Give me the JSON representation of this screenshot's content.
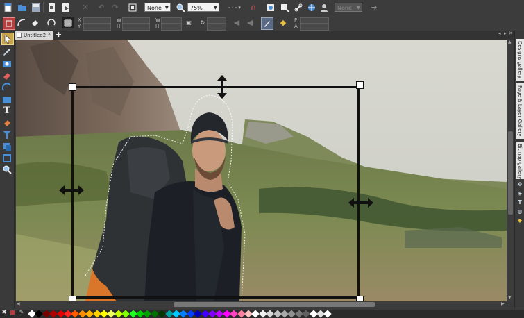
{
  "toolbar": {
    "quality_value": "None",
    "zoom_value": "75%",
    "disabled_combo_value": "None"
  },
  "document_tab": {
    "title": "Untitled2",
    "close_glyph": "×",
    "new_glyph": "+"
  },
  "infobar": {
    "labels": [
      "X",
      "Y",
      "W",
      "H",
      "W",
      "H",
      "P",
      "A"
    ]
  },
  "side_panels": [
    {
      "label": "Designs gallery"
    },
    {
      "label": "Page & Layer Gallery"
    },
    {
      "label": "Bitmap gallery"
    }
  ],
  "palette_colors": [
    "#ffffff",
    "#000000",
    "#7a0000",
    "#b00000",
    "#e00000",
    "#ff2020",
    "#ff5a00",
    "#ff8c00",
    "#ffb000",
    "#ffd200",
    "#ffff00",
    "#f0ff60",
    "#c8ff00",
    "#80ff00",
    "#20ff20",
    "#00d000",
    "#00a000",
    "#007000",
    "#003800",
    "#00a0a0",
    "#00c8ff",
    "#0080ff",
    "#0040ff",
    "#0000c0",
    "#4000ff",
    "#8000ff",
    "#c000ff",
    "#ff00ff",
    "#ff40c0",
    "#ff80a0",
    "#ffc0c0",
    "#ffffff",
    "#f0f0f0",
    "#d8d8d8",
    "#c0c0c0",
    "#a8a8a8",
    "#909090",
    "#787878",
    "#606060",
    "#ffffff",
    "#e0e0e0",
    "#ffffff"
  ]
}
